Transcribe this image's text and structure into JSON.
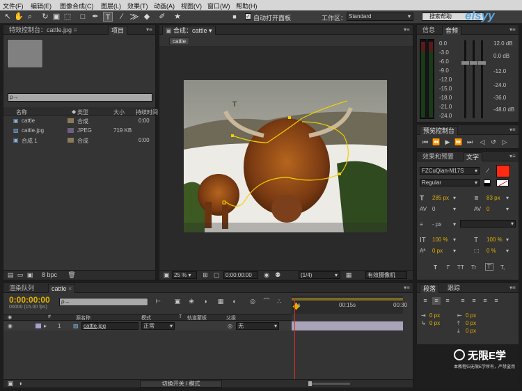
{
  "menu": [
    "文件(F)",
    "编辑(E)",
    "图像合成(C)",
    "图层(L)",
    "效果(T)",
    "动画(A)",
    "视图(V)",
    "窗口(W)",
    "帮助(H)"
  ],
  "toolbar": {
    "auto_open_panel": "自动打开面板",
    "workspace_label": "工作区：",
    "workspace_value": "Standard",
    "search_help": "搜索帮助"
  },
  "watermark_top": "elsyy",
  "project_panel": {
    "tabs": [
      "特效控制台：cattle.jpg",
      "项目"
    ],
    "search_placeholder": "ρ→",
    "columns": [
      "名称",
      "类型",
      "大小",
      "持续时间"
    ],
    "items": [
      {
        "name": "cattle",
        "type": "合成",
        "size": "",
        "duration": "0:00"
      },
      {
        "name": "cattle.jpg",
        "type": "JPEG",
        "size": "719 KB",
        "duration": ""
      },
      {
        "name": "合成 1",
        "type": "合成",
        "size": "",
        "duration": "0:00"
      }
    ],
    "bpc": "8 bpc"
  },
  "comp_panel": {
    "tab_label": "合成：cattle",
    "sub_tab": "cattle",
    "zoom": "25 %",
    "timecode": "0:00:00:00",
    "resolution": "(1/4)",
    "camera": "有效摄像机"
  },
  "info_panel": {
    "tabs": [
      "信息",
      "音频"
    ],
    "db_left": [
      "0.0",
      "-3.0",
      "-6.0",
      "-9.0",
      "-12.0",
      "-15.0",
      "-18.0",
      "-21.0",
      "-24.0"
    ],
    "db_right": [
      "12.0 dB",
      "0.0 dB",
      "-12.0",
      "-24.0",
      "-36.0",
      "-48.0 dB"
    ]
  },
  "preview_panel": {
    "title": "预览控制台"
  },
  "char_panel": {
    "tabs": [
      "效果和预置",
      "文字"
    ],
    "font": "FZCuQian-M17S",
    "style": "Regular",
    "size": "285 px",
    "leading": "83 px",
    "kerning": "0",
    "tracking": "0",
    "stroke_unit": "- px",
    "vscale": "100 %",
    "hscale": "100 %",
    "baseline": "0 px",
    "tsume": "0 %",
    "fill_color": "#ff2a12",
    "styles": [
      "T",
      "T",
      "TT",
      "Tr",
      "T'",
      "T,"
    ]
  },
  "timeline": {
    "tabs": [
      "渲染队列",
      "cattle"
    ],
    "timecode": "0:00:00:00",
    "fps": "00000 (15.00 fps)",
    "search_placeholder": "ρ→",
    "columns": [
      "#",
      "源名称",
      "模式",
      "T",
      "轨道蒙板",
      "父级"
    ],
    "layer": {
      "num": "1",
      "name": "cattle.jpg",
      "mode": "正常",
      "parent": "无"
    },
    "ruler": [
      "0s",
      "00:15s",
      "00:30"
    ],
    "toggle": "切换开关 / 模式"
  },
  "para_panel": {
    "tabs": [
      "段落",
      "跟踪"
    ],
    "values": [
      "0 px",
      "0 px",
      "0 px",
      "0 px",
      "0 px"
    ]
  },
  "brand": {
    "name": "无限E学",
    "sub": "本教程归无限E学所有，严禁盗用"
  },
  "colors": {
    "accent": "#e0b000",
    "blue_text": "#7fa8d6",
    "fill": "#ff2a12"
  }
}
